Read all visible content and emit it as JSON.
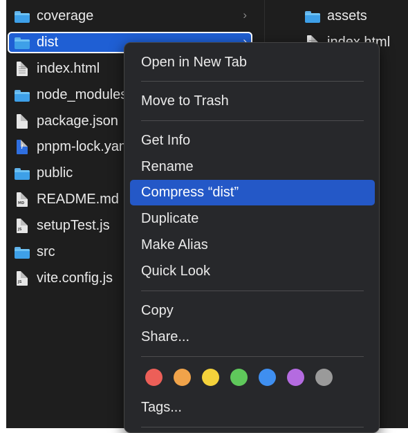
{
  "file_list": [
    {
      "name": "coverage",
      "kind": "folder",
      "chevron": "›",
      "selected": false
    },
    {
      "name": "dist",
      "kind": "folder",
      "chevron": "›",
      "selected": true
    },
    {
      "name": "index.html",
      "kind": "file",
      "badge": "",
      "selected": false
    },
    {
      "name": "node_modules",
      "kind": "folder",
      "selected": false
    },
    {
      "name": "package.json",
      "kind": "file",
      "badge": "",
      "selected": false
    },
    {
      "name": "pnpm-lock.yaml",
      "kind": "yaml",
      "selected": false
    },
    {
      "name": "public",
      "kind": "folder",
      "selected": false
    },
    {
      "name": "README.md",
      "kind": "file",
      "badge": "MD",
      "selected": false
    },
    {
      "name": "setupTest.js",
      "kind": "file",
      "badge": "JS",
      "selected": false
    },
    {
      "name": "src",
      "kind": "folder",
      "selected": false
    },
    {
      "name": "vite.config.js",
      "kind": "file",
      "badge": "JS",
      "selected": false
    }
  ],
  "preview_column": [
    {
      "name": "assets",
      "kind": "folder"
    },
    {
      "name": "index.html",
      "kind": "file"
    }
  ],
  "context_menu": {
    "open_new_tab": "Open in New Tab",
    "move_to_trash": "Move to Trash",
    "get_info": "Get Info",
    "rename": "Rename",
    "compress": "Compress “dist”",
    "duplicate": "Duplicate",
    "make_alias": "Make Alias",
    "quick_look": "Quick Look",
    "copy": "Copy",
    "share": "Share...",
    "tags": "Tags..."
  },
  "tag_colors": [
    {
      "name": "red",
      "hex": "#ec5f58"
    },
    {
      "name": "orange",
      "hex": "#f0a34a"
    },
    {
      "name": "yellow",
      "hex": "#f4d23b"
    },
    {
      "name": "green",
      "hex": "#5fc85b"
    },
    {
      "name": "blue",
      "hex": "#3f8ff0"
    },
    {
      "name": "purple",
      "hex": "#b46be0"
    },
    {
      "name": "gray",
      "hex": "#9a9a9a"
    }
  ],
  "colors": {
    "selection": "#1f5fd4",
    "menu_highlight": "#2458c7",
    "background": "#1e1e1e"
  }
}
